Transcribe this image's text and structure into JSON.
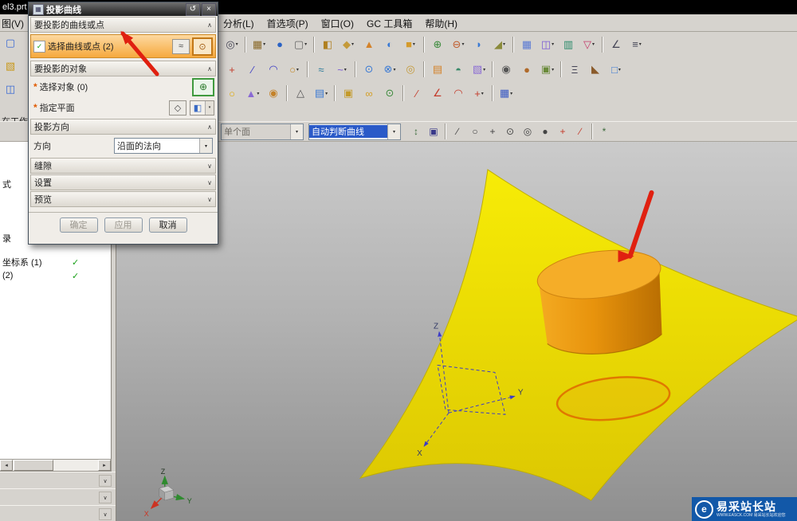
{
  "titlebar": {
    "file": "el3.prt"
  },
  "menu": {
    "partial": "图(V)",
    "items": [
      "分析(L)",
      "首选项(P)",
      "窗口(O)",
      "GC 工具箱",
      "帮助(H)"
    ]
  },
  "glyphs": {
    "check": "✓",
    "chevron_up": "∧",
    "chevron_down": "∨",
    "caret": "▾",
    "close": "×",
    "reset": "↺",
    "required": "*",
    "scroll_left": "◂",
    "scroll_right": "▸",
    "dialog_icon": "▦",
    "sel_curve_icon": "≈",
    "sel_point_icon": "⊙",
    "target_btn": "⊕",
    "plane_btn": "◇",
    "plane_main": "◧"
  },
  "toolbars": {
    "left": [
      {
        "n": "new-part-icon",
        "g": "▢",
        "c": "#3a6ad4"
      },
      {
        "n": "open-part-icon",
        "g": "▧",
        "c": "#c8981a"
      },
      {
        "n": "save-icon",
        "g": "◫",
        "c": "#3a6ad4"
      }
    ],
    "row1": [
      {
        "n": "zoom-icon",
        "g": "◎",
        "c": "#444455",
        "d": true
      },
      {
        "sep": true
      },
      {
        "n": "display-mode-icon",
        "g": "▦",
        "c": "#8a6a2a",
        "d": true
      },
      {
        "n": "shaded-view-icon",
        "g": "●",
        "c": "#2a62c4"
      },
      {
        "n": "view-layout-icon",
        "g": "▢",
        "c": "#666666",
        "d": true
      },
      {
        "sep": true
      },
      {
        "n": "datum-plane-icon",
        "g": "◧",
        "c": "#b08020"
      },
      {
        "n": "sketch-icon",
        "g": "◆",
        "c": "#c49a3a",
        "d": true
      },
      {
        "n": "extrude-icon",
        "g": "▲",
        "c": "#d4822a"
      },
      {
        "n": "revolve-icon",
        "g": "◐",
        "c": "#3a7ad4"
      },
      {
        "n": "block-icon",
        "g": "■",
        "c": "#d49a2a",
        "d": true
      },
      {
        "sep": true
      },
      {
        "n": "unite-icon",
        "g": "⊕",
        "c": "#3a8a3a"
      },
      {
        "n": "subtract-icon",
        "g": "⊖",
        "c": "#c05a2a",
        "d": true
      },
      {
        "n": "edge-blend-icon",
        "g": "◗",
        "c": "#3a7ad4"
      },
      {
        "n": "chamfer-icon",
        "g": "◢",
        "c": "#8a8a3a",
        "d": true
      },
      {
        "sep": true
      },
      {
        "n": "pattern-feature-icon",
        "g": "▦",
        "c": "#5a7ad4"
      },
      {
        "n": "mirror-feature-icon",
        "g": "◫",
        "c": "#7a5ad4",
        "d": true
      },
      {
        "n": "shell-icon",
        "g": "▥",
        "c": "#2a8a6a"
      },
      {
        "n": "trim-body-icon",
        "g": "▽",
        "c": "#c43a6a",
        "d": true
      },
      {
        "sep": true
      },
      {
        "n": "measure-icon",
        "g": "∠",
        "c": "#444455"
      },
      {
        "n": "more-commands-icon",
        "g": "≡",
        "c": "#444455",
        "d": true
      }
    ],
    "row2": [
      {
        "n": "point-icon",
        "g": "+",
        "c": "#c43a2a"
      },
      {
        "n": "line-icon",
        "g": "∕",
        "c": "#3a3ac4"
      },
      {
        "n": "arc-icon",
        "g": "◠",
        "c": "#3a3ac4"
      },
      {
        "n": "circle-icon",
        "g": "○",
        "c": "#c48a2a",
        "d": true
      },
      {
        "sep": true
      },
      {
        "n": "studio-spline-icon",
        "g": "≈",
        "c": "#2a7a9a"
      },
      {
        "n": "helix-icon",
        "g": "~",
        "c": "#7a5ad4",
        "d": true
      },
      {
        "sep": true
      },
      {
        "n": "project-curve-icon",
        "g": "⊙",
        "c": "#3a7ad4"
      },
      {
        "n": "intersect-curve-icon",
        "g": "⊗",
        "c": "#3a7ad4",
        "d": true
      },
      {
        "n": "offset-curve-icon",
        "g": "◎",
        "c": "#c49a3a"
      },
      {
        "sep": true
      },
      {
        "n": "through-curves-icon",
        "g": "▤",
        "c": "#d4822a"
      },
      {
        "n": "swept-icon",
        "g": "◓",
        "c": "#3a8a6a"
      },
      {
        "n": "ruled-surface-icon",
        "g": "▧",
        "c": "#8a6ad4",
        "d": true
      },
      {
        "sep": true
      },
      {
        "n": "hole-icon",
        "g": "◉",
        "c": "#555555"
      },
      {
        "n": "boss-icon",
        "g": "●",
        "c": "#b06a2a"
      },
      {
        "n": "pocket-icon",
        "g": "▣",
        "c": "#6a8a3a",
        "d": true
      },
      {
        "sep": true
      },
      {
        "n": "thread-icon",
        "g": "Ξ",
        "c": "#444455"
      },
      {
        "n": "draft-icon",
        "g": "◣",
        "c": "#8a5a2a"
      },
      {
        "n": "scale-body-icon",
        "g": "□",
        "c": "#3a7ad4",
        "d": true
      }
    ],
    "row3": [
      {
        "n": "sphere-icon",
        "g": "○",
        "c": "#e0a800"
      },
      {
        "n": "cone-icon",
        "g": "▲",
        "c": "#8a6ad4",
        "d": true
      },
      {
        "n": "cylinder-icon",
        "g": "◉",
        "c": "#c4822a"
      },
      {
        "sep": true
      },
      {
        "n": "triangle-mesh-icon",
        "g": "△",
        "c": "#555555"
      },
      {
        "n": "face-icon",
        "g": "▤",
        "c": "#3a7ad4",
        "d": true
      },
      {
        "sep": true
      },
      {
        "n": "group-icon",
        "g": "▣",
        "c": "#c49a2a"
      },
      {
        "n": "wave-link-icon",
        "g": "∞",
        "c": "#d4a02a"
      },
      {
        "n": "constraint-icon",
        "g": "⊙",
        "c": "#3a8a3a"
      },
      {
        "sep": true
      },
      {
        "n": "sketch-line-icon",
        "g": "∕",
        "c": "#c43a2a"
      },
      {
        "n": "sketch-angle-icon",
        "g": "∠",
        "c": "#c43a2a"
      },
      {
        "n": "sketch-arc-icon",
        "g": "◠",
        "c": "#c43a2a"
      },
      {
        "n": "sketch-point-icon",
        "g": "+",
        "c": "#c43a2a",
        "d": true
      },
      {
        "sep": true
      },
      {
        "n": "grid-icon",
        "g": "▦",
        "c": "#3a5ac4",
        "d": true
      }
    ],
    "selbar": [
      {
        "n": "snap-point-toggle-icon",
        "g": "↕",
        "c": "#3a6a3a"
      },
      {
        "n": "point-on-curve-icon",
        "g": "▣",
        "c": "#3a3a8a"
      },
      {
        "sep": true
      },
      {
        "n": "end-point-icon",
        "g": "∕",
        "c": "#444444"
      },
      {
        "n": "mid-point-icon",
        "g": "○",
        "c": "#444444"
      },
      {
        "n": "intersection-point-icon",
        "g": "+",
        "c": "#444444"
      },
      {
        "n": "arc-center-icon",
        "g": "⊙",
        "c": "#444444"
      },
      {
        "n": "quadrant-point-icon",
        "g": "◎",
        "c": "#444444"
      },
      {
        "n": "existing-point-icon",
        "g": "●",
        "c": "#444444"
      },
      {
        "n": "point-constructor-icon",
        "g": "+",
        "c": "#c43a2a"
      },
      {
        "n": "slash-icon",
        "g": "∕",
        "c": "#c43a2a"
      },
      {
        "sep": true
      },
      {
        "n": "settings-icon",
        "g": "*",
        "c": "#3a6a3a"
      }
    ]
  },
  "selection_bar": {
    "filter": "单个面",
    "curve_rule": "自动判断曲线"
  },
  "dialog": {
    "title": "投影曲线",
    "groups": {
      "curves_header": "要投影的曲线或点",
      "select_curve": "选择曲线或点 (2)",
      "objects_header": "要投影的对象",
      "select_object": "选择对象 (0)",
      "specify_plane": "指定平面",
      "direction_header": "投影方向",
      "direction_label": "方向",
      "direction_value": "沿面的法向",
      "gap_header": "缝隙",
      "settings_header": "设置",
      "preview_header": "预览"
    },
    "buttons": {
      "ok": "确定",
      "apply": "应用",
      "cancel": "取消"
    }
  },
  "navigator": {
    "prompt": "在工作部...",
    "rows": [
      "式",
      "录",
      "坐标系 (1)",
      "(2)"
    ],
    "check": "✓"
  },
  "viewport": {
    "csys_labels": {
      "x": "X",
      "y": "Y",
      "z": "Z"
    },
    "triad_labels": {
      "x": "X",
      "y": "Y",
      "z": "Z"
    }
  },
  "watermark": {
    "logo": "e",
    "title": "易采站长站",
    "subtitle": "WWW.EASCK.COM 易采站长站欢迎您"
  },
  "colors": {
    "surface_light": "#f7ec06",
    "surface_dark": "#dcc702",
    "surface_edge": "#bfae00",
    "cyl_light": "#f4ab22",
    "cyl_mid": "#e8930c",
    "cyl_dark": "#b96e02",
    "cyl_top": "#f5ad28",
    "cyl_top_edge": "#cf8410",
    "proj_orange": "#e07800",
    "arrow_red": "#e02010",
    "csys_blue": "#3c3cc8",
    "axis_green": "#2e8b2e",
    "axis_red": "#cc3322",
    "check_green": "#18a018",
    "req_orange": "#e05a00",
    "watermark_blue": "#1258a8"
  }
}
